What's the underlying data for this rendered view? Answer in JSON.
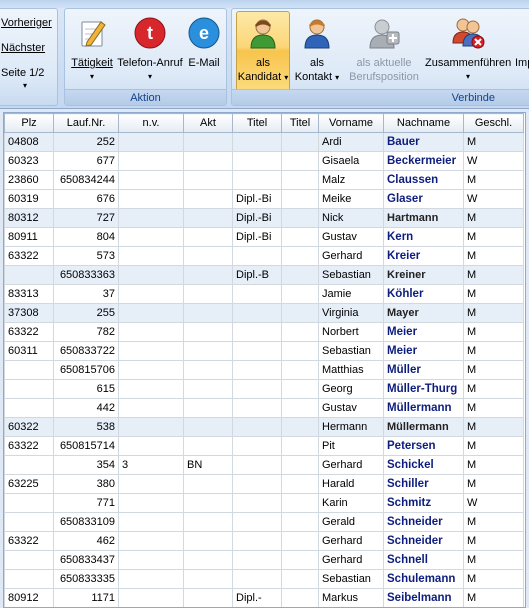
{
  "ribbon": {
    "nav": {
      "prev": "Vorheriger",
      "next": "Nächster",
      "page": "Seite 1/2"
    },
    "aktion": {
      "label": "Aktion",
      "buttons": [
        {
          "label": "Tätigkeit",
          "icon": "pencil-icon"
        },
        {
          "label": "Telefon-Anruf",
          "icon": "phone-call-icon"
        },
        {
          "label": "E-Mail",
          "icon": "email-icon"
        }
      ]
    },
    "verbinde": {
      "label": "Verbinde",
      "buttons": [
        {
          "line1": "als",
          "line2": "Kandidat",
          "icon": "candidate-person-icon",
          "active": true
        },
        {
          "line1": "als",
          "line2": "Kontakt",
          "icon": "contact-person-icon"
        },
        {
          "line1": "als aktuelle",
          "line2": "Berufsposition",
          "icon": "add-position-icon",
          "disabled": true
        },
        {
          "line1": "Zusammenführen",
          "icon": "merge-persons-icon"
        },
        {
          "line1": "Imp"
        }
      ]
    }
  },
  "table": {
    "columns": [
      "Plz",
      "Lauf.Nr.",
      "n.v.",
      "Akt",
      "Titel",
      "Titel",
      "Vorname",
      "Nachname",
      "Geschl."
    ],
    "rows": [
      [
        "04808",
        "252",
        "",
        "",
        "",
        "",
        "Ardi",
        "Bauer",
        "M"
      ],
      [
        "60323",
        "677",
        "",
        "",
        "",
        "",
        "Gisaela",
        "Beckermeier",
        "W"
      ],
      [
        "23860",
        "650834244",
        "",
        "",
        "",
        "",
        "Malz",
        "Claussen",
        "M"
      ],
      [
        "60319",
        "676",
        "",
        "",
        "Dipl.-Bi",
        "",
        "Meike",
        "Glaser",
        "W"
      ],
      [
        "80312",
        "727",
        "",
        "",
        "Dipl.-Bi",
        "",
        "Nick",
        "Hartmann",
        "M"
      ],
      [
        "80911",
        "804",
        "",
        "",
        "Dipl.-Bi",
        "",
        "Gustav",
        "Kern",
        "M"
      ],
      [
        "63322",
        "573",
        "",
        "",
        "",
        "",
        "Gerhard",
        "Kreier",
        "M"
      ],
      [
        "",
        "650833363",
        "",
        "",
        "Dipl.-B",
        "",
        "Sebastian",
        "Kreiner",
        "M"
      ],
      [
        "83313",
        "37",
        "",
        "",
        "",
        "",
        "Jamie",
        "Köhler",
        "M"
      ],
      [
        "37308",
        "255",
        "",
        "",
        "",
        "",
        "Virginia",
        "Mayer",
        "M"
      ],
      [
        "63322",
        "782",
        "",
        "",
        "",
        "",
        "Norbert",
        "Meier",
        "M"
      ],
      [
        "60311",
        "650833722",
        "",
        "",
        "",
        "",
        "Sebastian",
        "Meier",
        "M"
      ],
      [
        "",
        "650815706",
        "",
        "",
        "",
        "",
        "Matthias",
        "Müller",
        "M"
      ],
      [
        "",
        "615",
        "",
        "",
        "",
        "",
        "Georg",
        "Müller-Thurg",
        "M"
      ],
      [
        "",
        "442",
        "",
        "",
        "",
        "",
        "Gustav",
        "Müllermann",
        "M"
      ],
      [
        "60322",
        "538",
        "",
        "",
        "",
        "",
        "Hermann",
        "Müllermann",
        "M"
      ],
      [
        "63322",
        "650815714",
        "",
        "",
        "",
        "",
        "Pit",
        "Petersen",
        "M"
      ],
      [
        "",
        "354",
        "3",
        "BN",
        "",
        "",
        "Gerhard",
        "Schickel",
        "M"
      ],
      [
        "63225",
        "380",
        "",
        "",
        "",
        "",
        "Harald",
        "Schiller",
        "M"
      ],
      [
        "",
        "771",
        "",
        "",
        "",
        "",
        "Karin",
        "Schmitz",
        "W"
      ],
      [
        "",
        "650833109",
        "",
        "",
        "",
        "",
        "Gerald",
        "Schneider",
        "M"
      ],
      [
        "63322",
        "462",
        "",
        "",
        "",
        "",
        "Gerhard",
        "Schneider",
        "M"
      ],
      [
        "",
        "650833437",
        "",
        "",
        "",
        "",
        "Gerhard",
        "Schnell",
        "M"
      ],
      [
        "",
        "650833335",
        "",
        "",
        "",
        "",
        "Sebastian",
        "Schulemann",
        "M"
      ],
      [
        "80912",
        "1171",
        "",
        "",
        "Dipl.-",
        "",
        "Markus",
        "Seibelmann",
        "M"
      ]
    ],
    "shaded_rows": [
      0,
      4,
      7,
      9,
      15
    ],
    "gray_names": [
      4,
      7,
      9,
      15
    ]
  }
}
